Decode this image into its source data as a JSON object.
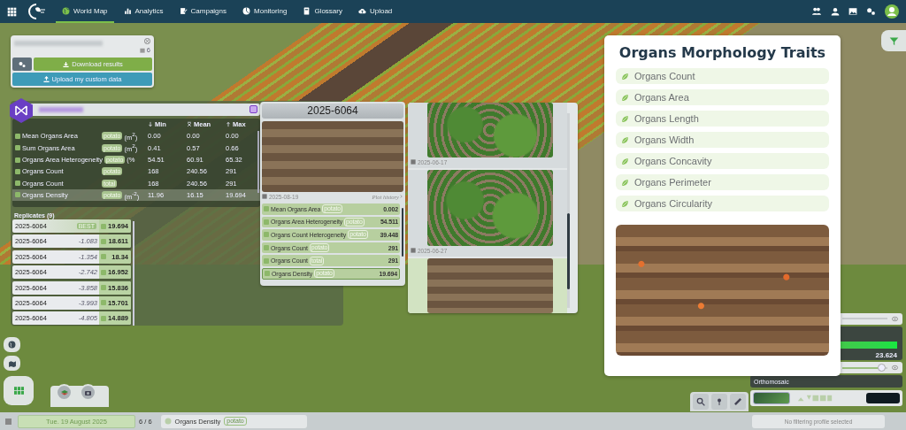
{
  "topbar": {
    "nav": [
      {
        "label": "World Map",
        "kind": "globe",
        "selected": true
      },
      {
        "label": "Analytics",
        "kind": "chart",
        "selected": false
      },
      {
        "label": "Campaigns",
        "kind": "clipboard",
        "selected": false
      },
      {
        "label": "Monitoring",
        "kind": "pie",
        "selected": false
      },
      {
        "label": "Glossary",
        "kind": "book",
        "selected": false
      },
      {
        "label": "Upload",
        "kind": "cloud",
        "selected": false
      }
    ]
  },
  "project_panel": {
    "count": "6",
    "buttons": [
      {
        "label": "Download results",
        "kind": "download"
      },
      {
        "label": "Upload my custom data",
        "kind": "upload"
      }
    ]
  },
  "stats_table": {
    "columns": [
      {
        "label": "Min",
        "kind": "down"
      },
      {
        "label": "Mean",
        "kind": "mean"
      },
      {
        "label": "Max",
        "kind": "up"
      }
    ],
    "rows": [
      {
        "name": "Mean Organs Area",
        "tag": "potato",
        "unit": "(m$^{2}$)",
        "min": "0.00",
        "mean": "0.00",
        "max": "0.00",
        "selected": false
      },
      {
        "name": "Sum Organs Area",
        "tag": "potato",
        "unit": "(m$^{2}$)",
        "min": "0.41",
        "mean": "0.57",
        "max": "0.66",
        "selected": false
      },
      {
        "name": "Organs Area Heterogeneity",
        "tag": "potato",
        "unit": "(%",
        "min": "54.51",
        "mean": "60.91",
        "max": "65.32",
        "selected": false
      },
      {
        "name": "Organs Count",
        "tag": "potato",
        "min": "168",
        "mean": "240.56",
        "max": "291",
        "selected": false
      },
      {
        "name": "Organs Count",
        "tag": "total",
        "min": "168",
        "mean": "240.56",
        "max": "291",
        "selected": false
      },
      {
        "name": "Organs Density",
        "tag": "potato",
        "unit": "(m$^{-2}$)",
        "min": "11.96",
        "mean": "16.15",
        "max": "19.694",
        "selected": true
      }
    ]
  },
  "replicates": {
    "title": "Replicates (9)",
    "rows": [
      {
        "name": "2025-6064",
        "badge": "BEST",
        "value": "19.694",
        "selected": true
      },
      {
        "name": "2025-6064",
        "diff": "-1.083",
        "value": "18.611",
        "selected": false
      },
      {
        "name": "2025-6064",
        "diff": "-1.354",
        "value": "18.34",
        "selected": false
      },
      {
        "name": "2025-6064",
        "diff": "-2.742",
        "value": "16.952",
        "selected": false
      },
      {
        "name": "2025-6064",
        "diff": "-3.858",
        "value": "15.836",
        "selected": false
      },
      {
        "name": "2025-6064",
        "diff": "-3.993",
        "value": "15.701",
        "selected": false
      },
      {
        "name": "2025-6064",
        "diff": "-4.805",
        "value": "14.889",
        "selected": false
      }
    ]
  },
  "plot_card": {
    "title": "2025-6064",
    "date": "2025-08-19",
    "link": "Plot history",
    "traits": [
      {
        "name": "Mean Organs Area",
        "tag": "potato",
        "value": "0.002",
        "selected": false
      },
      {
        "name": "Organs Area Heterogeneity",
        "tag": "potato",
        "value": "54.511",
        "selected": false
      },
      {
        "name": "Organs Count Heterogeneity",
        "tag": "potato",
        "value": "39.448",
        "selected": false
      },
      {
        "name": "Organs Count",
        "tag": "potato",
        "value": "291",
        "selected": false
      },
      {
        "name": "Organs Count",
        "tag": "total",
        "value": "291",
        "selected": false
      },
      {
        "name": "Organs Density",
        "tag": "potato",
        "value": "19.694",
        "selected": true
      }
    ]
  },
  "history": {
    "items": [
      {
        "date": "2025-06-17",
        "kind": "canopy",
        "selected": false
      },
      {
        "date": "2025-06-27",
        "kind": "canopy",
        "selected": false
      },
      {
        "kind": "soil",
        "selected": true
      }
    ]
  },
  "traits_panel": {
    "title": "Organs Morphology Traits",
    "items": [
      "Organs Count",
      "Organs Area",
      "Organs Length",
      "Organs Width",
      "Organs Concavity",
      "Organs Perimeter",
      "Organs Circularity"
    ]
  },
  "layers": {
    "value": "23.624",
    "label": "Orthomosaic",
    "opacity": {
      "level": 0.95
    }
  },
  "status_bar": {
    "date": "Tue. 19 August 2025",
    "page": "6 / 6",
    "layer": "Organs Density",
    "tag": "potato",
    "filter": "No filtering profile selected"
  }
}
